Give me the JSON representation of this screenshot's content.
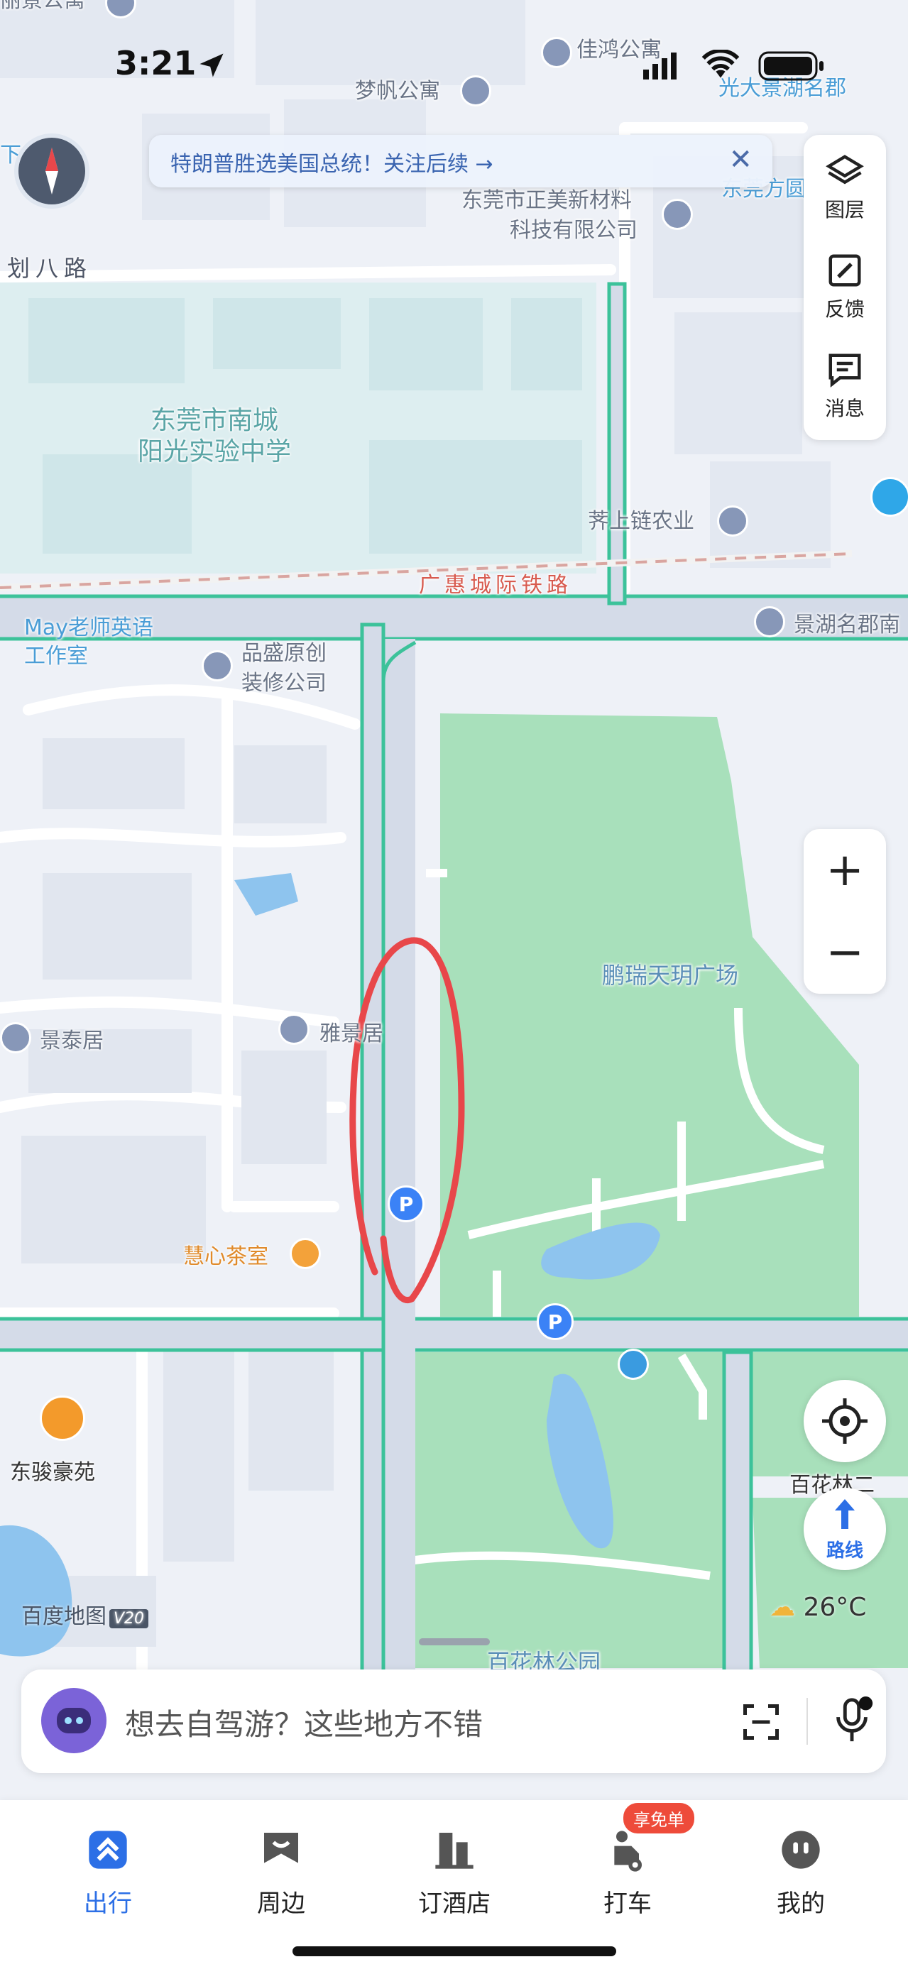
{
  "status_bar": {
    "time": "3:21"
  },
  "notice": {
    "text": "特朗普胜选美国总统！关注后续 →",
    "close": "✕"
  },
  "side_panel": {
    "layers": "图层",
    "feedback": "反馈",
    "messages": "消息"
  },
  "zoom": {
    "in": "+",
    "out": "−"
  },
  "route_button": "路线",
  "weather": "26°C",
  "map_logo": {
    "text": "百度地图",
    "version": "V20"
  },
  "search": {
    "placeholder": "想去自驾游？这些地方不错"
  },
  "tabs": [
    {
      "label": "出行",
      "active": true
    },
    {
      "label": "周边"
    },
    {
      "label": "订酒店"
    },
    {
      "label": "打车"
    },
    {
      "label": "我的"
    }
  ],
  "taxi_badge": "享免单",
  "labels": {
    "top_left_poi": "丽景公寓",
    "jiahong": "佳鸿公寓",
    "mengfan": "梦帆公寓",
    "guangda": "光大景湖名郡",
    "xiacun": "下屯村",
    "zhengmei_1": "东莞市正美新材料",
    "zhengmei_2": "科技有限公司",
    "dongguan_fang": "东莞方圆",
    "huaba_road": "划八路",
    "school_1": "东莞市南城",
    "school_2": "阳光实验中学",
    "jishang": "荠上链农业",
    "railway": "广惠城际铁路",
    "may_1": "May老师英语",
    "may_2": "工作室",
    "pinsheng_1": "品盛原创",
    "pinsheng_2": "装修公司",
    "jinghu_nan": "景湖名郡南",
    "plaza": "鹏瑞天玥广场",
    "jingtai": "景泰居",
    "yajingju": "雅景居",
    "huixin": "慧心茶室",
    "dongjun": "东骏豪苑",
    "baihualin_side": "百花林二",
    "baihualin_park": "百花林公园"
  },
  "colors": {
    "park": "#a8e0bb",
    "road_fill": "#d4dbe8",
    "road_edge": "#3cc29a",
    "water": "#8ec4ee",
    "annotation": "#e8474a",
    "accent": "#2c6fe6"
  },
  "icons": [
    "location-arrow-icon",
    "layers-icon",
    "feedback-icon",
    "message-icon",
    "locate-icon",
    "route-icon",
    "scan-icon",
    "mic-icon",
    "parking-icon",
    "restroom-icon",
    "tea-icon",
    "house-icon"
  ]
}
